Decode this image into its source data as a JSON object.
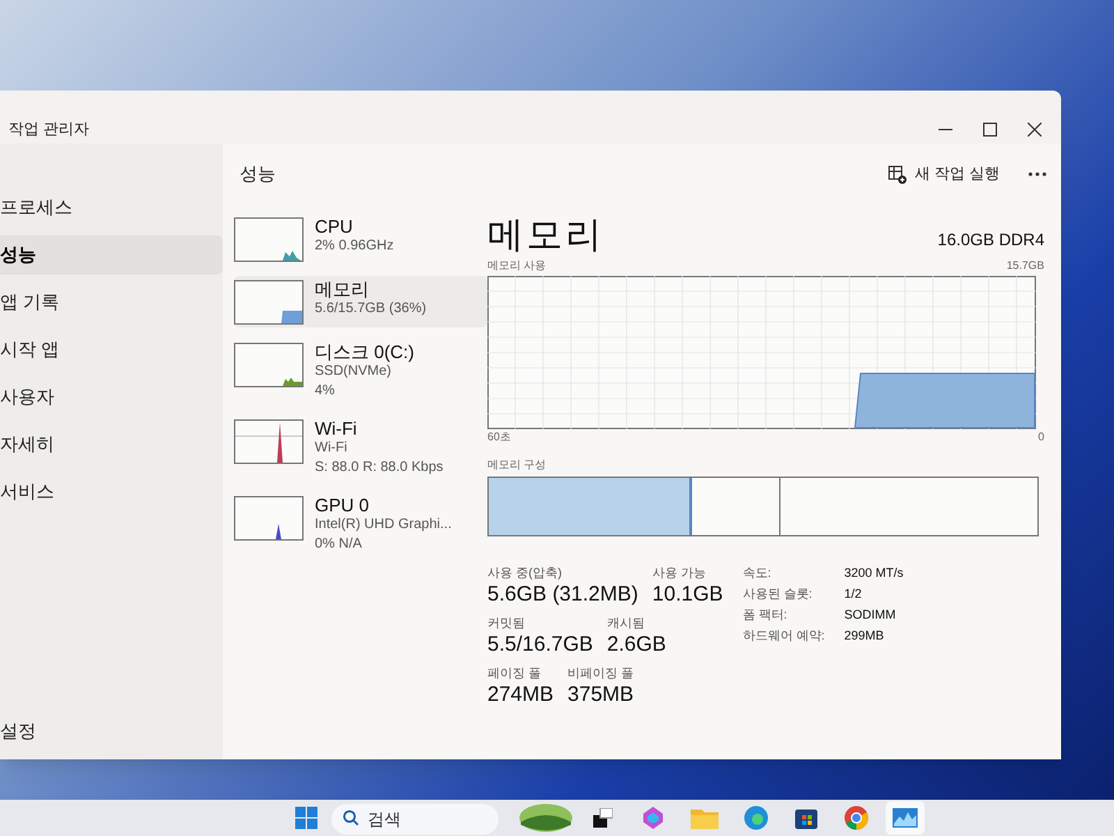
{
  "window": {
    "title": "작업 관리자"
  },
  "sidebar": {
    "items": [
      {
        "label": "프로세스",
        "selected": false
      },
      {
        "label": "성능",
        "selected": true
      },
      {
        "label": "앱 기록",
        "selected": false
      },
      {
        "label": "시작 앱",
        "selected": false
      },
      {
        "label": "사용자",
        "selected": false
      },
      {
        "label": "자세히",
        "selected": false
      },
      {
        "label": "서비스",
        "selected": false
      }
    ],
    "settings": "설정"
  },
  "page": {
    "title": "성능",
    "run_task_button": "새 작업 실행"
  },
  "devices": [
    {
      "kind": "cpu",
      "name": "CPU",
      "details": [
        "2% 0.96GHz"
      ],
      "color": "#3f9fa8",
      "selected": false
    },
    {
      "kind": "memory",
      "name": "메모리",
      "details": [
        "5.6/15.7GB (36%)"
      ],
      "color": "#6f9fd8",
      "selected": true
    },
    {
      "kind": "disk",
      "name": "디스크 0(C:)",
      "details": [
        "SSD(NVMe)",
        "4%"
      ],
      "color": "#6a9a2a",
      "selected": false
    },
    {
      "kind": "network",
      "name": "Wi-Fi",
      "details": [
        "Wi-Fi",
        "S: 88.0 R: 88.0 Kbps"
      ],
      "color": "#c03a5a",
      "selected": false
    },
    {
      "kind": "gpu",
      "name": "GPU 0",
      "details": [
        "Intel(R) UHD Graphi...",
        "0% N/A"
      ],
      "color": "#4a4ac8",
      "selected": false
    }
  ],
  "memory": {
    "title": "메모리",
    "spec": "16.0GB DDR4",
    "usage_label": "메모리 사용",
    "usage_max": "15.7GB",
    "x_start": "60초",
    "x_end": "0",
    "composition_label": "메모리 구성",
    "stat_rows": [
      [
        {
          "label": "사용 중(압축)",
          "value": "5.6GB (31.2MB)"
        },
        {
          "label": "사용 가능",
          "value": "10.1GB"
        }
      ],
      [
        {
          "label": "커밋됨",
          "value": "5.5/16.7GB"
        },
        {
          "label": "캐시됨",
          "value": "2.6GB"
        }
      ],
      [
        {
          "label": "페이징 풀",
          "value": "274MB"
        },
        {
          "label": "비페이징 풀",
          "value": "375MB"
        }
      ]
    ],
    "properties": [
      {
        "label": "속도:",
        "value": "3200 MT/s"
      },
      {
        "label": "사용된 슬롯:",
        "value": "1/2"
      },
      {
        "label": "폼 팩터:",
        "value": "SODIMM"
      },
      {
        "label": "하드웨어 예약:",
        "value": "299MB"
      }
    ]
  },
  "taskbar": {
    "search_placeholder": "검색"
  }
}
